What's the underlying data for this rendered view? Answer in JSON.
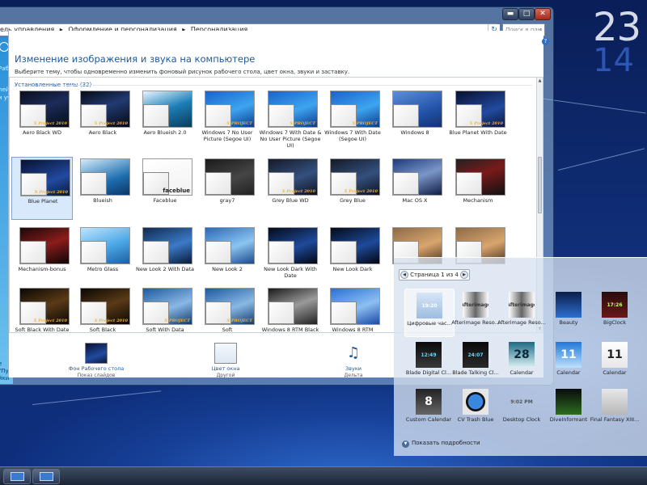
{
  "clock": {
    "hours": "23",
    "minutes": "14"
  },
  "window": {
    "controls": {
      "minimize": "▬",
      "maximize": "□",
      "close": "✕"
    },
    "breadcrumb": [
      "ель управления",
      "▸",
      "Оформление и персонализация",
      "▸",
      "Персонализация"
    ],
    "refresh_icon": "↻",
    "search_placeholder": "Поиск в пан",
    "left_pane": [
      "Рабочего",
      "",
      "лей мыши",
      "и учетной"
    ],
    "left_pane_bottom": [
      "е",
      "\"Пуск\"",
      "йки"
    ],
    "help": "?",
    "title": "Изменение изображения и звука на компьютере",
    "subtitle": "Выберите тему, чтобы одновременно изменить фоновый рисунок рабочего стола, цвет окна, звуки и заставку.",
    "section": "Установленные темы (32)",
    "themes": [
      {
        "name": "Aero Black WD",
        "bg": "linear-gradient(160deg,#0a0d1c,#1b2c5a 45%,#070b14)",
        "wm": "X Project 2010"
      },
      {
        "name": "Aero Black",
        "bg": "linear-gradient(160deg,#070a14,#223a72 45%,#060810)",
        "wm": "X Project 2010"
      },
      {
        "name": "Aero Blueish 2.0",
        "bg": "linear-gradient(160deg,#e8f6ff,#1c7fb8 50%,#0b3a5b)",
        "wm": ""
      },
      {
        "name": "Windows 7 No User Picture (Segoe UI)",
        "bg": "linear-gradient(160deg,#1b63c8,#3ea4f0 55%,#0a3a8a)",
        "wm": "X PROJECT"
      },
      {
        "name": "Windows 7 With Date & No User Picture (Segoe UI)",
        "bg": "linear-gradient(160deg,#1b63c8,#3ea4f0 55%,#0a3a8a)",
        "wm": "X PROJECT"
      },
      {
        "name": "Windows 7 With Date (Segoe UI)",
        "bg": "linear-gradient(160deg,#1b63c8,#3ea4f0 55%,#0a3a8a)",
        "wm": "X PROJECT"
      },
      {
        "name": "Windows 8",
        "bg": "linear-gradient(160deg,#5d8fd8,#2253a8 60%,#123272)",
        "wm": ""
      },
      {
        "name": "Blue Planet With Date",
        "bg": "linear-gradient(160deg,#081030,#214aa0 60%,#0a1838)",
        "wm": "X Project 2010"
      },
      {
        "name": "Blue Planet",
        "bg": "linear-gradient(160deg,#081030,#214aa0 60%,#0a1838)",
        "wm": "X Project 2010",
        "selected": true
      },
      {
        "name": "Blueish",
        "bg": "linear-gradient(160deg,#d4ebfa,#1f6fb0 60%,#0c3666)",
        "wm": ""
      },
      {
        "name": "Faceblue",
        "bg": "linear-gradient(160deg,#ffffff,#f2f2f2)",
        "wm": "faceblue"
      },
      {
        "name": "gray7",
        "bg": "linear-gradient(160deg,#1a1a1a,#454545 55%,#222)",
        "wm": ""
      },
      {
        "name": "Grey Blue WD",
        "bg": "linear-gradient(160deg,#141a28,#34507e 55%,#0d1220)",
        "wm": "X Project 2010"
      },
      {
        "name": "Grey Blue",
        "bg": "linear-gradient(160deg,#141a28,#34507e 55%,#0d1220)",
        "wm": "X Project 2010"
      },
      {
        "name": "Mac OS X",
        "bg": "linear-gradient(160deg,#1c3a7a,#7a96c8 50%,#101d44)",
        "wm": ""
      },
      {
        "name": "Mechanism",
        "bg": "linear-gradient(160deg,#222,#7a1a1a 45%,#111)",
        "wm": ""
      },
      {
        "name": "Mechanism-bonus",
        "bg": "linear-gradient(160deg,#1a0808,#8c1c1c 50%,#0d0505)",
        "wm": ""
      },
      {
        "name": "Metro Glass",
        "bg": "linear-gradient(160deg,#bfe4ff,#4aa6e6 55%,#1d5fa0)",
        "wm": ""
      },
      {
        "name": "New Look 2 With Data",
        "bg": "linear-gradient(160deg,#112a50,#3b7ac8 55%,#0a1a36)",
        "wm": ""
      },
      {
        "name": "New Look 2",
        "bg": "linear-gradient(160deg,#2a6ab8,#8cc4f0 55%,#1a4a8a)",
        "wm": ""
      },
      {
        "name": "New Look Dark With Date",
        "bg": "linear-gradient(160deg,#050a18,#1e4a9a 55%,#030612)",
        "wm": ""
      },
      {
        "name": "New Look Dark",
        "bg": "linear-gradient(160deg,#050a18,#1e4a9a 55%,#030612)",
        "wm": ""
      },
      {
        "name": "",
        "bg": "linear-gradient(160deg,#8c6a46,#d9a56e 55%,#4c3420)",
        "wm": ""
      },
      {
        "name": "",
        "bg": "linear-gradient(160deg,#8c6a46,#d9a56e 55%,#4c3420)",
        "wm": ""
      },
      {
        "name": "Soft Black With Date",
        "bg": "linear-gradient(160deg,#0a0705,#5a3a16 50%,#0a0604)",
        "wm": "X Project 2010"
      },
      {
        "name": "Soft Black",
        "bg": "linear-gradient(160deg,#0a0705,#5a3a16 50%,#0a0604)",
        "wm": "X Project 2010"
      },
      {
        "name": "Soft With Data",
        "bg": "linear-gradient(160deg,#1e5a9e,#8ab8e4 55%,#0f3b6e)",
        "wm": "X PROJECT"
      },
      {
        "name": "Soft",
        "bg": "linear-gradient(160deg,#1e5a9e,#8ab8e4 55%,#0f3b6e)",
        "wm": "X PROJECT"
      },
      {
        "name": "Windows 8 RTM Black",
        "bg": "linear-gradient(160deg,#1a1a1a,#9a9a9a 50%,#222)",
        "wm": ""
      },
      {
        "name": "Windows 8 RTM",
        "bg": "linear-gradient(160deg,#2c6fd6,#8cc0f2 55%,#1a4aa6)",
        "wm": ""
      }
    ],
    "bottom": [
      {
        "l1": "Фон Рабочего стола",
        "l2": "Показ слайдов"
      },
      {
        "l1": "Цвет окна",
        "l2": "Другой"
      },
      {
        "l1": "Звуки",
        "l2": "Дельта"
      }
    ]
  },
  "gadgets": {
    "page": "Страница 1 из 4",
    "prev": "◀",
    "next": "▶",
    "items": [
      {
        "label": "Цифровые час...",
        "icon_text": "19:20",
        "icon_bg": "linear-gradient(#d8e6f6,#9dbde0)",
        "icon_color": "#ffffff",
        "selected": true
      },
      {
        "label": "Afterimage Reso...",
        "icon_text": "Afterimage",
        "icon_bg": "linear-gradient(90deg,#fff,#666,#fff)",
        "icon_color": "#333"
      },
      {
        "label": "Afterimage Reso...",
        "icon_text": "Afterimage",
        "icon_bg": "linear-gradient(90deg,#fff,#666,#fff)",
        "icon_color": "#333"
      },
      {
        "label": "Beauty",
        "icon_text": "",
        "icon_bg": "linear-gradient(#0b1e4a,#2d6fd0)",
        "icon_color": "#fff"
      },
      {
        "label": "BigClock",
        "icon_text": "17:26",
        "icon_bg": "linear-gradient(#2a0c0c,#6a1818)",
        "icon_color": "#c2ff70"
      },
      {
        "label": "Blade Digital Cl...",
        "icon_text": "12:49",
        "icon_bg": "linear-gradient(#0a0a0a,#3a3a3a)",
        "icon_color": "#62d6ff"
      },
      {
        "label": "Blade Talking Cl...",
        "icon_text": "24:07",
        "icon_bg": "linear-gradient(#0a0a0a,#2a2a2a)",
        "icon_color": "#62d6ff"
      },
      {
        "label": "Calendar",
        "icon_text": "28",
        "icon_bg": "linear-gradient(#1d6a84,#dff1f5)",
        "icon_color": "#0a2a3a"
      },
      {
        "label": "Calendar",
        "icon_text": "11",
        "icon_bg": "linear-gradient(#1e78d8,#bfe0fb)",
        "icon_color": "#fff"
      },
      {
        "label": "Calendar",
        "icon_text": "11",
        "icon_bg": "linear-gradient(#fff,#e6e6e6)",
        "icon_color": "#222"
      },
      {
        "label": "Custom Calendar",
        "icon_text": "8",
        "icon_bg": "linear-gradient(#222,#666)",
        "icon_color": "#fff"
      },
      {
        "label": "CV Trash Blue",
        "icon_text": "",
        "icon_bg": "radial-gradient(circle,#3a87e0 40%,#111 42%,#111 52%,#e6e6e6 54%)",
        "icon_color": "#fff"
      },
      {
        "label": "Desktop Clock",
        "icon_text": "9:02 PM",
        "icon_bg": "transparent",
        "icon_color": "#555"
      },
      {
        "label": "DiveInformant",
        "icon_text": "",
        "icon_bg": "linear-gradient(#0a0a0a,#2b6e20)",
        "icon_color": "#fff"
      },
      {
        "label": "Final Fantasy XIII...",
        "icon_text": "",
        "icon_bg": "linear-gradient(#e8e8e8,#b8b8b8)",
        "icon_color": "#333"
      }
    ],
    "details": "Показать подробности",
    "details_icon": "▼"
  }
}
